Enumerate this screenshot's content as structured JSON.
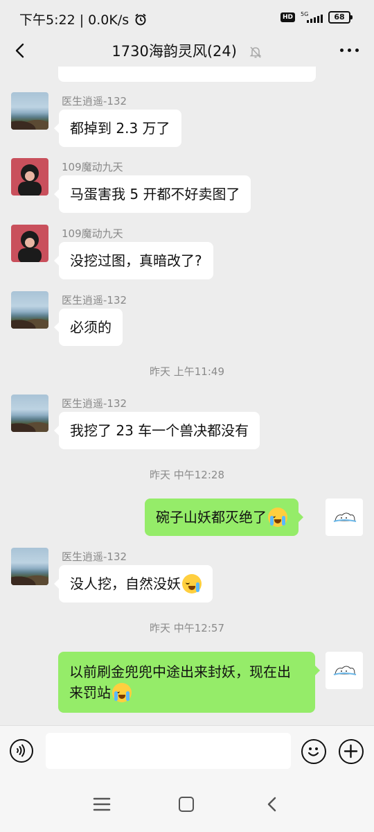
{
  "status_bar": {
    "time": "下午5:22",
    "speed": "0.0K/s",
    "hd_label": "HD",
    "network_label": "5G",
    "battery": "68"
  },
  "header": {
    "title": "1730海韵灵风(24)"
  },
  "messages": [
    {
      "sender": "医生逍遥-132",
      "text": "都掉到 2.3 万了"
    },
    {
      "sender": "109魔动九天",
      "text": "马蛋害我 5 开都不好卖图了"
    },
    {
      "sender": "109魔动九天",
      "text": "没挖过图，真暗改了?"
    },
    {
      "sender": "医生逍遥-132",
      "text": "必须的"
    },
    {
      "sender": "医生逍遥-132",
      "text": "我挖了 23 车一个兽决都没有"
    },
    {
      "text": "碗子山妖都灭绝了"
    },
    {
      "sender": "医生逍遥-132",
      "text": "没人挖，自然没妖"
    },
    {
      "text": "以前刷金兜兜中途出来封妖，现在出来罚站"
    }
  ],
  "timestamps": [
    "昨天 上午11:49",
    "昨天 中午12:28",
    "昨天 中午12:57"
  ],
  "icons": {
    "back": "chevron-left-icon",
    "mute": "bell-off-icon",
    "more": "more-dots-icon",
    "voice": "voice-icon",
    "emoji": "emoji-icon",
    "plus": "plus-icon",
    "crying": "crying-face-emoji",
    "laughing": "laughing-face-emoji"
  },
  "colors": {
    "background": "#ededed",
    "my_bubble": "#95ec69",
    "other_bubble": "#ffffff"
  }
}
